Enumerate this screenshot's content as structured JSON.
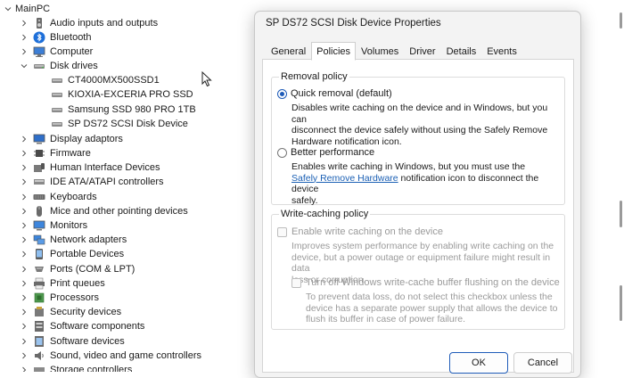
{
  "tree": {
    "root": "MainPC",
    "categories": [
      "Audio inputs and outputs",
      "Bluetooth",
      "Computer",
      "Disk drives",
      "Display adaptors",
      "Firmware",
      "Human Interface Devices",
      "IDE ATA/ATAPI controllers",
      "Keyboards",
      "Mice and other pointing devices",
      "Monitors",
      "Network adapters",
      "Portable Devices",
      "Ports (COM & LPT)",
      "Print queues",
      "Processors",
      "Security devices",
      "Software components",
      "Software devices",
      "Sound, video and game controllers",
      "Storage controllers"
    ],
    "disk_children": [
      "CT4000MX500SSD1",
      "KIOXIA-EXCERIA PRO SSD",
      "Samsung SSD 980 PRO 1TB",
      "SP DS72 SCSI Disk Device"
    ]
  },
  "dialog": {
    "title": "SP DS72 SCSI Disk Device Properties",
    "tabs": [
      "General",
      "Policies",
      "Volumes",
      "Driver",
      "Details",
      "Events"
    ],
    "removal": {
      "title": "Removal policy",
      "quick_label": "Quick removal (default)",
      "quick_desc": [
        "Disables write caching on the device and in Windows, but you can",
        "disconnect the device safely without using the Safely Remove",
        "Hardware notification icon."
      ],
      "better_label": "Better performance",
      "better_desc_1": "Enables write caching in Windows, but you must use the",
      "better_link": "Safely Remove Hardware",
      "better_desc_2": " notification icon to disconnect the device",
      "better_desc_3": "safely."
    },
    "write_cache": {
      "title": "Write-caching policy",
      "enable_label": "Enable write caching on the device",
      "enable_desc": [
        "Improves system performance by enabling write caching on the",
        "device, but a power outage or equipment failure might result in data",
        "loss or corruption."
      ],
      "flush_label": "Turn off Windows write-cache buffer flushing on the device",
      "flush_desc": [
        "To prevent data loss, do not select this checkbox unless the",
        "device has a separate power supply that allows the device to",
        "flush its buffer in case of power failure."
      ]
    },
    "ok_label": "OK",
    "cancel_label": "Cancel"
  },
  "colors": {
    "accent": "#1e5bb8",
    "link": "#1a5fb4",
    "disabled_text": "#9a9a9a"
  }
}
